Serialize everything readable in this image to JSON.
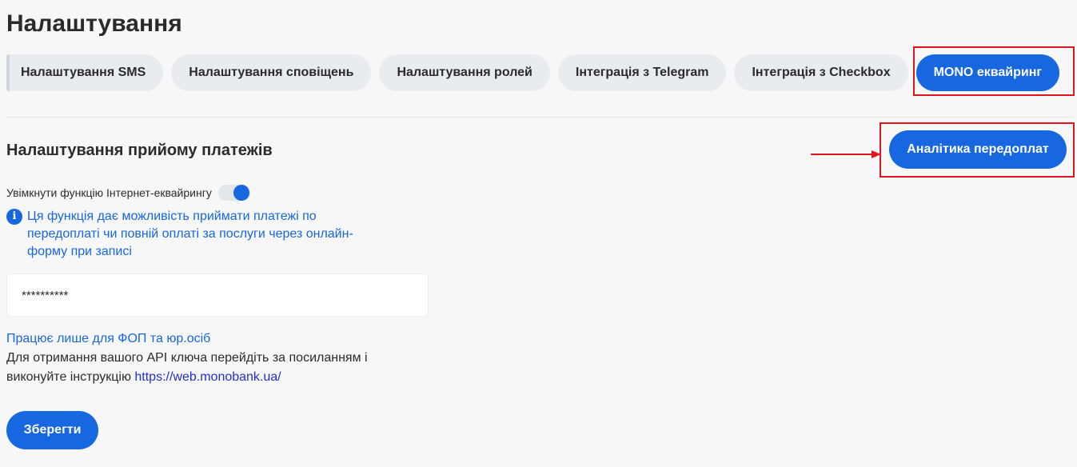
{
  "page": {
    "title": "Налаштування"
  },
  "tabs": [
    {
      "label": "Налаштування SMS",
      "active": false
    },
    {
      "label": "Налаштування сповіщень",
      "active": false
    },
    {
      "label": "Налаштування ролей",
      "active": false
    },
    {
      "label": "Інтеграція з Telegram",
      "active": false
    },
    {
      "label": "Інтеграція з Checkbox",
      "active": false
    },
    {
      "label": "MONO еквайринг",
      "active": true
    }
  ],
  "section": {
    "title": "Налаштування прийому платежів",
    "analytics_button": "Аналітика передоплат"
  },
  "toggle": {
    "label": "Увімкнути функцію Інтернет-еквайрингу",
    "enabled": true
  },
  "info": {
    "icon": "info-icon",
    "text": "Ця функція дає можливість приймати платежі по передоплаті чи повній оплаті за послуги через онлайн-форму при записі"
  },
  "api_key": {
    "value": "**********"
  },
  "note": {
    "highlight": "Працює лише для ФОП та юр.осіб",
    "line": "Для отримання вашого API ключа перейдіть за посиланням і виконуйте інструкцію",
    "link": "https://web.monobank.ua/"
  },
  "save_button": "Зберегти",
  "colors": {
    "accent": "#1767e0",
    "annotation": "#e2141b",
    "tab_bg": "#e8ebf0"
  }
}
